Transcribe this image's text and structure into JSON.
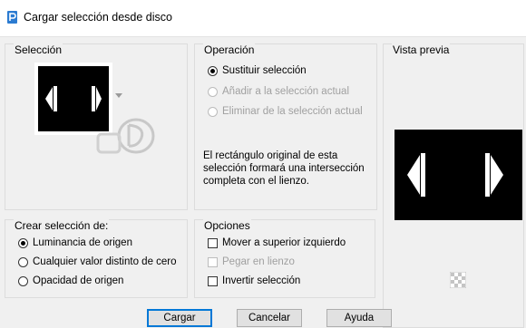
{
  "window": {
    "title": "Cargar selección desde disco"
  },
  "seleccion": {
    "title": "Selección"
  },
  "operacion": {
    "title": "Operación",
    "options": [
      {
        "label": "Sustituir selección",
        "checked": true,
        "disabled": false
      },
      {
        "label": "Añadir a la selección actual",
        "checked": false,
        "disabled": true
      },
      {
        "label": "Eliminar de la selección actual",
        "checked": false,
        "disabled": true
      }
    ],
    "description": "El rectángulo original de esta selección formará una intersección completa con el lienzo."
  },
  "vista_previa": {
    "title": "Vista previa"
  },
  "crear": {
    "title": "Crear selección de:",
    "options": [
      {
        "label": "Luminancia de origen",
        "checked": true
      },
      {
        "label": "Cualquier valor distinto de cero",
        "checked": false
      },
      {
        "label": "Opacidad de origen",
        "checked": false
      }
    ]
  },
  "opciones": {
    "title": "Opciones",
    "items": [
      {
        "label": "Mover a superior izquierdo",
        "checked": false,
        "disabled": false
      },
      {
        "label": "Pegar en lienzo",
        "checked": false,
        "disabled": true
      },
      {
        "label": "Invertir selección",
        "checked": false,
        "disabled": false
      }
    ]
  },
  "buttons": {
    "load": "Cargar",
    "cancel": "Cancelar",
    "help": "Ayuda"
  },
  "colors": {
    "accent": "#0078d7",
    "preview_bg": "#000000",
    "disabled_text": "#a0a0a0"
  }
}
